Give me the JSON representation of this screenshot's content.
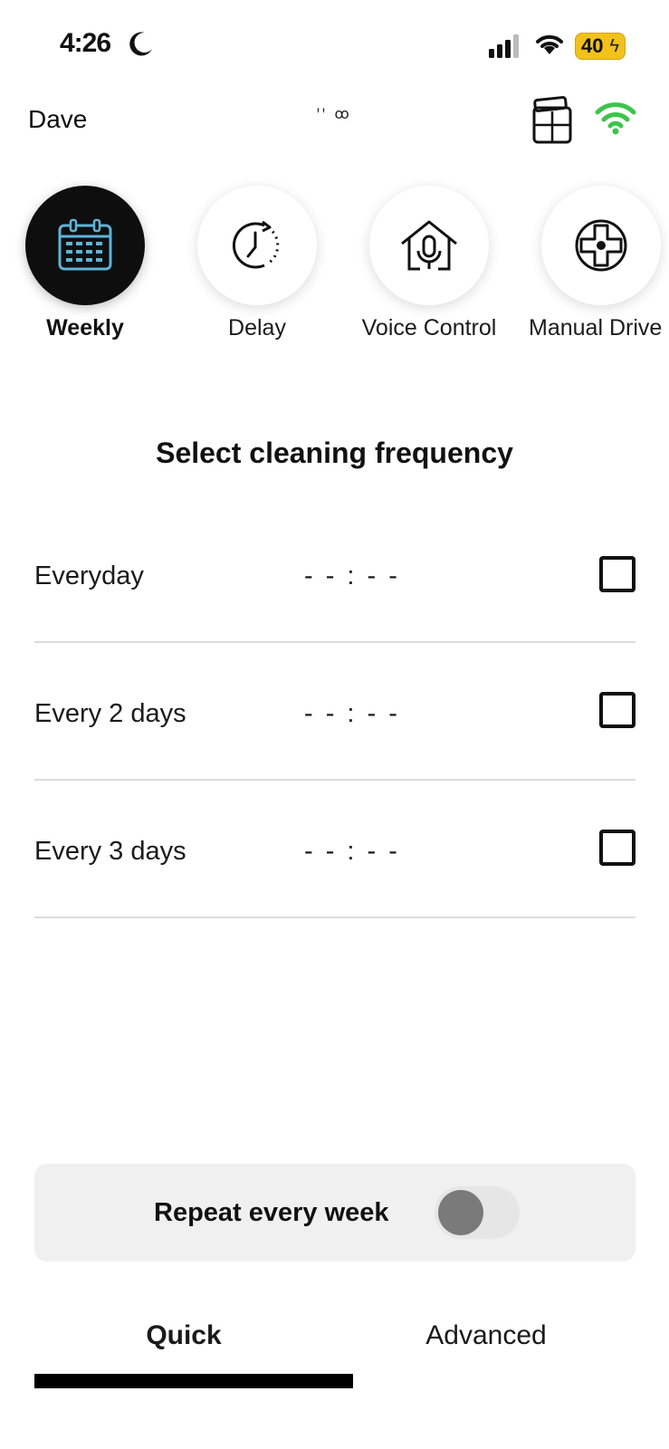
{
  "status_bar": {
    "time": "4:26",
    "battery": "40"
  },
  "header": {
    "device_name": "Dave",
    "center_text": "ꞌꞌ ꝏ"
  },
  "modes": [
    {
      "label": "Weekly",
      "icon": "calendar-icon",
      "active": true
    },
    {
      "label": "Delay",
      "icon": "timer-icon",
      "active": false
    },
    {
      "label": "Voice Control",
      "icon": "home-microphone-icon",
      "active": false
    },
    {
      "label": "Manual Drive",
      "icon": "dpad-icon",
      "active": false
    }
  ],
  "section_title": "Select cleaning frequency",
  "frequency_rows": [
    {
      "label": "Everyday",
      "time": "- - : - -",
      "checked": false
    },
    {
      "label": "Every 2 days",
      "time": "- - : - -",
      "checked": false
    },
    {
      "label": "Every 3 days",
      "time": "- - : - -",
      "checked": false
    }
  ],
  "repeat": {
    "label": "Repeat every week",
    "enabled": false
  },
  "tabs": [
    {
      "label": "Quick",
      "active": true
    },
    {
      "label": "Advanced",
      "active": false
    }
  ],
  "colors": {
    "accent_active": "#0e0e0e",
    "calendar_blue": "#5fb3d8",
    "wifi_green": "#3cc44b",
    "battery_yellow": "#f2c11a"
  }
}
